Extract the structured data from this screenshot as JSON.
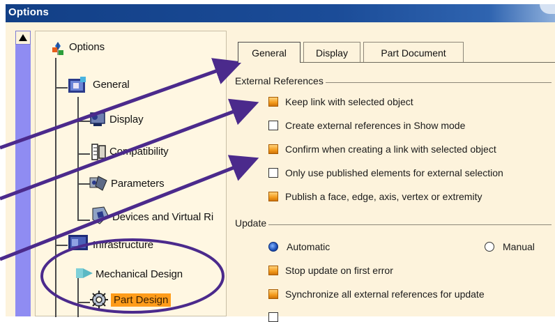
{
  "window": {
    "title": "Options"
  },
  "tree": {
    "root": "Options",
    "general": "General",
    "display": "Display",
    "compatibility": "Compatibility",
    "parameters": "Parameters",
    "devices": "Devices and Virtual Ri",
    "infrastructure": "Infrastructure",
    "mechanical_design": "Mechanical Design",
    "part_design": "Part Design"
  },
  "tabs": [
    "General",
    "Display",
    "Part Document"
  ],
  "external_references": {
    "label": "External References",
    "options": [
      {
        "label": "Keep link with selected object",
        "checked": true
      },
      {
        "label": "Create external references in Show mode",
        "checked": false
      },
      {
        "label": "Confirm when creating a link with selected object",
        "checked": true
      },
      {
        "label": "Only use published elements for external selection",
        "checked": false
      },
      {
        "label": "Publish a face, edge, axis, vertex or extremity",
        "checked": true
      }
    ]
  },
  "update": {
    "label": "Update",
    "automatic_label": "Automatic",
    "manual_label": "Manual",
    "selected": "automatic",
    "options": [
      {
        "label": "Stop update on first error",
        "checked": true
      },
      {
        "label": "Synchronize all external references for update",
        "checked": true
      }
    ]
  },
  "colors": {
    "titlebar": "#1b4c98",
    "panel": "#fdf3dc",
    "scrollbar": "#8f8cf2",
    "annotation": "#4b2a8c",
    "selection": "#ff9c1a"
  }
}
